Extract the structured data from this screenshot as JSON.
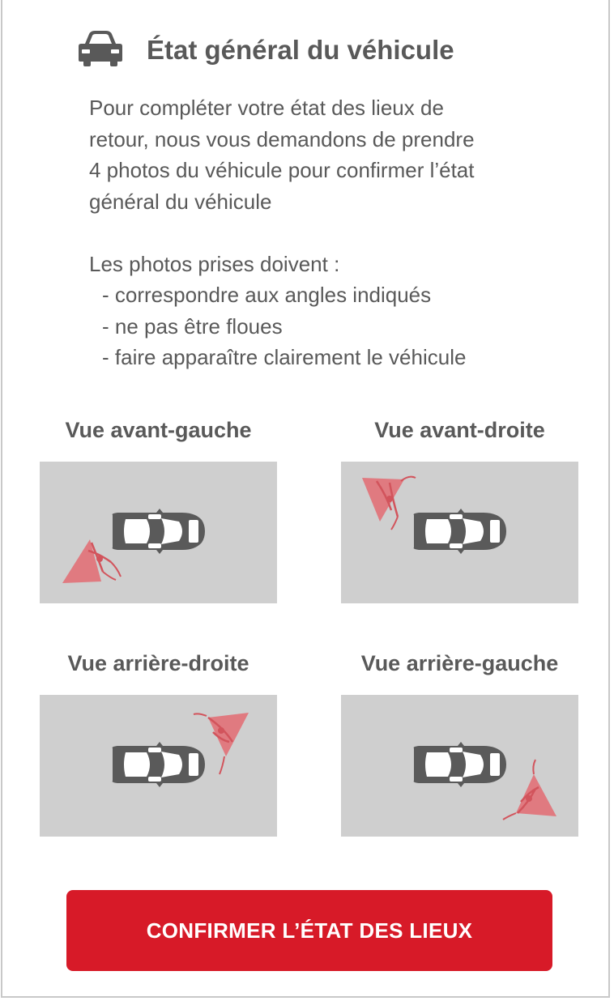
{
  "header": {
    "icon": "car-icon",
    "title": "État général du véhicule"
  },
  "intro": {
    "paragraph": [
      "Pour compléter votre état des lieux de",
      "retour, nous vous demandons de prendre",
      "4 photos du véhicule pour confirmer l’état",
      "général du véhicule"
    ],
    "requirements_title": "Les photos prises doivent :",
    "requirements": [
      "correspondre aux angles indiqués",
      "ne pas être floues",
      "faire apparaître clairement le véhicule"
    ]
  },
  "views": [
    {
      "label": "Vue avant-gauche",
      "icon": "camera-angle-front-left-icon"
    },
    {
      "label": "Vue avant-droite",
      "icon": "camera-angle-front-right-icon"
    },
    {
      "label": "Vue arrière-droite",
      "icon": "camera-angle-rear-right-icon"
    },
    {
      "label": "Vue arrière-gauche",
      "icon": "camera-angle-rear-left-icon"
    }
  ],
  "confirm_button": {
    "label": "CONFIRMER L’ÉTAT DES LIEUX"
  },
  "colors": {
    "accent": "#d71a28",
    "text": "#595959",
    "panel": "#cfcfcf",
    "eye_cone": "#e07a80"
  }
}
